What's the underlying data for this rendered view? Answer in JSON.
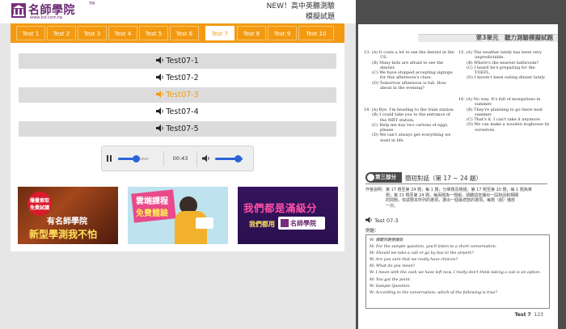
{
  "header": {
    "logo_text": "名師學院",
    "logo_tm": "TM",
    "logo_url": "www.ksf.com.tw",
    "title_line1": "NEW！高中英聽測驗",
    "title_line2": "模擬試題"
  },
  "tabs": [
    {
      "label": "Test 1",
      "active": false
    },
    {
      "label": "Test 2",
      "active": false
    },
    {
      "label": "Test 3",
      "active": false
    },
    {
      "label": "Test 4",
      "active": false
    },
    {
      "label": "Test 5",
      "active": false
    },
    {
      "label": "Test 6",
      "active": false
    },
    {
      "label": "Test 7",
      "active": true
    },
    {
      "label": "Test 8",
      "active": false
    },
    {
      "label": "Test 9",
      "active": false
    },
    {
      "label": "Test 10",
      "active": false
    }
  ],
  "audio_list": [
    {
      "label": "Test07-1",
      "active": false
    },
    {
      "label": "Test07-2",
      "active": false
    },
    {
      "label": "Test07-3",
      "active": true
    },
    {
      "label": "Test07-4",
      "active": false
    },
    {
      "label": "Test07-5",
      "active": false
    }
  ],
  "player": {
    "time": "00:43",
    "progress_fraction": 0.6,
    "volume_fraction": 0.85
  },
  "banners": {
    "b1_line1": "爆量索取",
    "b1_line2": "免費試讀",
    "b1_line3": "有名師學院",
    "b1_line4": "新型學測我不怕",
    "b2_line1": "雲端課程",
    "b2_line2": "免費體驗",
    "b3_line1": "我們都是滿級分",
    "b3_line2": "我們都用",
    "b3_line3": "名師學院"
  },
  "book": {
    "unit_title": "第3單元　聽力測驗模擬試題",
    "q13": [
      "13. (A) It costs a lot to see the dentist in the",
      "US.",
      "(B) Many kids are afraid to see the",
      "dentist.",
      "(C) We have stopped accepting signups",
      "for this afternoon's class.",
      "(D) Tomorrow afternoon is full. How",
      "about in the evening?"
    ],
    "q14": [
      "14. (A) Bye. I'm heading to the train station.",
      "(B) I could take you to the entrance of",
      "the MRT station.",
      "(C) Help me buy two cartons of eggs,",
      "please.",
      "(D) We can't always get everything we",
      "want in life."
    ],
    "q15": [
      "15. (A) The weather lately has been very",
      "unpredictable.",
      "(B) Where's the nearest bathroom?",
      "(C) I heard he's preparing for the",
      "TOEFL.",
      "(D) I haven't been eating dinner lately."
    ],
    "q16": [
      "16. (A) No way. It's full of mosquitoes in",
      "summer.",
      "(B) They're planning to go there next",
      "summer.",
      "(C) That's it. I can't take it anymore.",
      "(D) We can make a wooden doghouse by",
      "ourselves."
    ],
    "part3_badge": "第三部分",
    "part3_title": "簡短對話（第 17 ~ 24 題）",
    "instructions": [
      "作答說明：第 17 題至第 24 題，每 1 題，分單題及題組；第 17 題至第 20 題，每 1 題為單",
      "題；第 21 題至第 24 題，每兩題為一題組，請聽語音播出一段對話和相關",
      "的問題，依試題本所列的選項，選出一個最適當的選項。每題（組）播放",
      "一次。"
    ],
    "audio_label": "Test 07-3",
    "example_label": "例題：",
    "example_lines": [
      "W: 請聽到題號播放",
      "M: For the sample question, you'll listen to a short conversation.",
      "M: Should we take a cab or go by bus to the airport?",
      "W: Are you sure that we really have choices?",
      "M: What do you mean?",
      "W: I mean with the cash we have left now, I really don't think taking a cab is an option.",
      "M: You got the point.",
      "W: Sample Question.",
      "W: According to the conversation, which of the following is true?"
    ],
    "footer_test": "Test 7",
    "footer_page": "123"
  }
}
